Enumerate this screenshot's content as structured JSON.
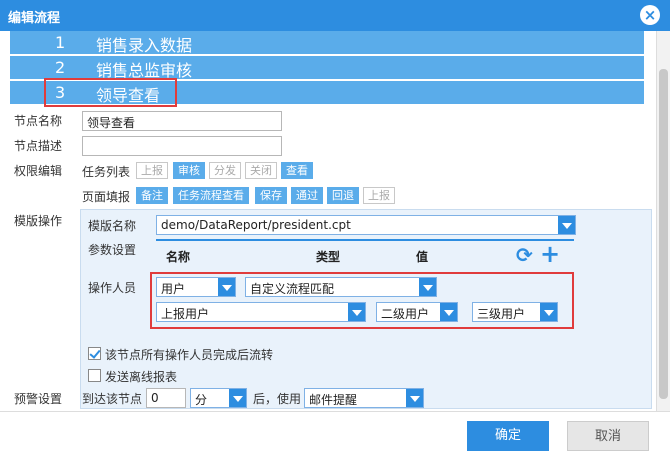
{
  "window": {
    "title": "编辑流程"
  },
  "steps": [
    {
      "num": "1",
      "name": "销售录入数据"
    },
    {
      "num": "2",
      "name": "销售总监审核"
    },
    {
      "num": "3",
      "name": "领导查看"
    }
  ],
  "labels": {
    "node_name": "节点名称",
    "node_desc": "节点描述",
    "perm_edit": "权限编辑",
    "task_list": "任务列表",
    "page_fill": "页面填报",
    "template_op": "模版操作",
    "template_name": "模版名称",
    "param_set": "参数设置",
    "operator": "操作人员",
    "alert": "预警设置",
    "arrive": "到达该节点",
    "after_use": "后，使用"
  },
  "fields": {
    "node_name_value": "领导查看",
    "node_desc_value": "",
    "template_value": "demo/DataReport/president.cpt",
    "alert_num": "0",
    "alert_unit": "分",
    "alert_method": "邮件提醒"
  },
  "task_buttons": [
    {
      "label": "上报",
      "on": false
    },
    {
      "label": "审核",
      "on": true
    },
    {
      "label": "分发",
      "on": false
    },
    {
      "label": "关闭",
      "on": false
    },
    {
      "label": "查看",
      "on": true
    }
  ],
  "page_buttons": [
    {
      "label": "备注",
      "on": true
    },
    {
      "label": "任务流程查看",
      "on": true
    },
    {
      "label": "保存",
      "on": true
    },
    {
      "label": "通过",
      "on": true
    },
    {
      "label": "回退",
      "on": true
    },
    {
      "label": "上报",
      "on": false
    }
  ],
  "param_headers": {
    "name": "名称",
    "type": "类型",
    "value": "值"
  },
  "operators": {
    "type": "用户",
    "rule": "自定义流程匹配",
    "report_user": "上报用户",
    "level2": "二级用户",
    "level3": "三级用户"
  },
  "options": {
    "finish_flow": "该节点所有操作人员完成后流转",
    "send_offline": "发送离线报表"
  },
  "footer": {
    "ok": "确定",
    "cancel": "取消"
  },
  "colors": {
    "accent": "#2d8de0",
    "step_bg": "#5aacea",
    "highlight": "#e03c3c"
  }
}
